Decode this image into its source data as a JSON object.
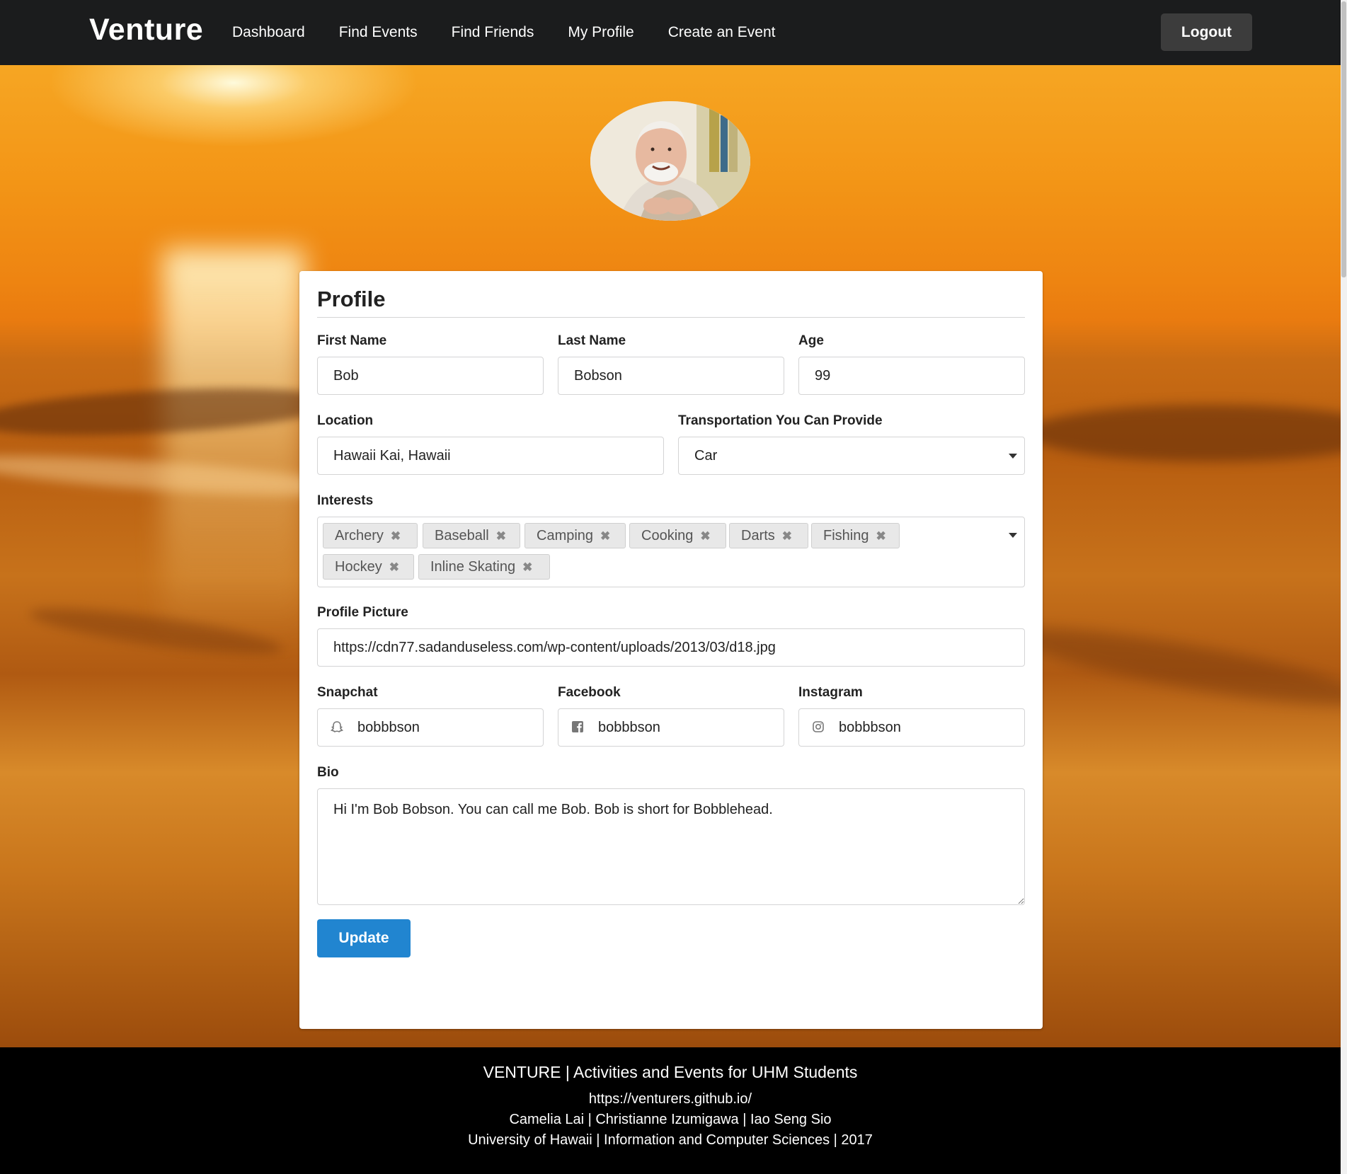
{
  "nav": {
    "brand": "Venture",
    "links": [
      "Dashboard",
      "Find Events",
      "Find Friends",
      "My Profile",
      "Create an Event"
    ],
    "logout": "Logout"
  },
  "profile": {
    "title": "Profile",
    "first_name_label": "First Name",
    "first_name": "Bob",
    "last_name_label": "Last Name",
    "last_name": "Bobson",
    "age_label": "Age",
    "age": "99",
    "location_label": "Location",
    "location": "Hawaii Kai, Hawaii",
    "transport_label": "Transportation You Can Provide",
    "transport": "Car",
    "interests_label": "Interests",
    "interests": [
      "Archery",
      "Baseball",
      "Camping",
      "Cooking",
      "Darts",
      "Fishing",
      "Hockey",
      "Inline Skating"
    ],
    "picture_label": "Profile Picture",
    "picture_url": "https://cdn77.sadanduseless.com/wp-content/uploads/2013/03/d18.jpg",
    "snapchat_label": "Snapchat",
    "snapchat": "bobbbson",
    "facebook_label": "Facebook",
    "facebook": "bobbbson",
    "instagram_label": "Instagram",
    "instagram": "bobbbson",
    "bio_label": "Bio",
    "bio": "Hi I'm Bob Bobson. You can call me Bob. Bob is short for Bobblehead.",
    "update": "Update"
  },
  "footer": {
    "line1": "VENTURE | Activities and Events for UHM Students",
    "line2": "https://venturers.github.io/",
    "line3": "Camelia Lai | Christianne Izumigawa | Iao Seng Sio",
    "line4": "University of Hawaii | Information and Computer Sciences | 2017"
  },
  "colors": {
    "navbar": "#1b1c1d",
    "primary_button": "#2185d0",
    "footer": "#000000"
  },
  "icons": {
    "snapchat": "snapchat-icon",
    "facebook": "facebook-icon",
    "instagram": "instagram-icon",
    "dropdown": "caret-down-icon",
    "remove": "close-icon"
  }
}
